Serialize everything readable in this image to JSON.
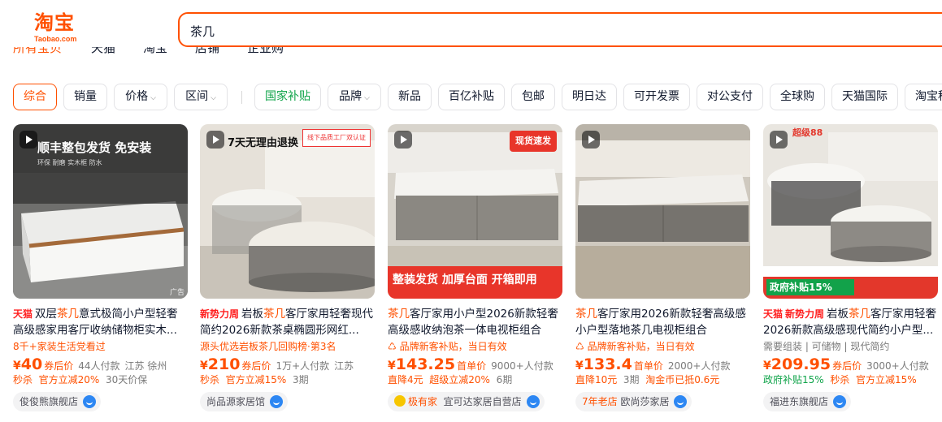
{
  "logo": {
    "cn": "淘宝",
    "en": "Taobao.com"
  },
  "search": {
    "query": "茶几"
  },
  "tabs": [
    {
      "label": "所有宝贝"
    },
    {
      "label": "天猫"
    },
    {
      "label": "淘宝"
    },
    {
      "label": "店铺"
    },
    {
      "label": "企业购"
    }
  ],
  "filters": [
    {
      "label": "综合"
    },
    {
      "label": "销量"
    },
    {
      "label": "价格"
    },
    {
      "label": "区间"
    },
    {
      "label": "国家补贴"
    },
    {
      "label": "品牌"
    },
    {
      "label": "新品"
    },
    {
      "label": "百亿补贴"
    },
    {
      "label": "包邮"
    },
    {
      "label": "明日达"
    },
    {
      "label": "可开发票"
    },
    {
      "label": "对公支付"
    },
    {
      "label": "全球购"
    },
    {
      "label": "天猫国际"
    },
    {
      "label": "淘宝秒"
    }
  ],
  "products": [
    {
      "img_banner": "顺丰整包发货 免安装",
      "img_small": "环保 耐磨 实木框 防水",
      "img_corner": "广告",
      "tag": "天猫",
      "title_a": "双层",
      "title_hl": "茶几",
      "title_b": "意式极简小户型轻奢高级感家用客厅收纳储物柜实木...",
      "sub": "8千+家装生活党看过",
      "sub_grey": "",
      "price_int": "40",
      "price_label": "券后价",
      "sold": "44人付款",
      "location": "江苏 徐州",
      "promo": [
        "秒杀",
        "官方立减20%",
        "30天价保"
      ],
      "store": "俊俊熊旗舰店"
    },
    {
      "img_banner": "7天无理由退换",
      "img_small": "线下品质工厂双认证",
      "img_corner": "",
      "tag": "新势力周",
      "title_a": "岩板",
      "title_hl": "茶几",
      "title_b": "客厅家用轻奢现代简约2026新款茶桌椭圆形网红...",
      "sub": "源头优选岩板茶几回购榜·第3名",
      "sub_grey": "",
      "price_int": "210",
      "price_label": "券后价",
      "sold": "1万+人付款",
      "location": "江苏",
      "promo": [
        "秒杀",
        "官方立减15%",
        "3期"
      ],
      "store": "尚品源家居馆"
    },
    {
      "img_banner": "整装发货 加厚台面 开箱即用",
      "img_small": "现货速发",
      "img_corner": "",
      "tag": "",
      "title_a": "",
      "title_hl": "茶几",
      "title_b": "客厅家用小户型2026新款轻奢高级感收纳泡茶一体电视柜组合",
      "sub": "品牌新客补贴，当日有效",
      "sub_grey": "",
      "price_int": "143.25",
      "price_label": "首单价",
      "sold": "9000+人付款",
      "location": "",
      "promo": [
        "直降4元",
        "超级立减20%",
        "6期"
      ],
      "store": "宜可达家居自营店",
      "store_brand": "极有家"
    },
    {
      "img_banner": "",
      "img_small": "",
      "img_corner": "",
      "tag": "",
      "title_a": "",
      "title_hl": "茶几",
      "title_b": "客厅家用2026新款轻奢高级感小户型落地茶几电视柜组合",
      "sub": "品牌新客补贴，当日有效",
      "sub_grey": "",
      "price_int": "133.4",
      "price_label": "首单价",
      "sold": "2000+人付款",
      "location": "",
      "promo": [
        "直降10元",
        "3期",
        "淘金币已抵0.6元"
      ],
      "store": "欧尚莎家居",
      "store_prefix": "7年老店"
    },
    {
      "img_banner": "超级88",
      "img_small": "政府补贴15%",
      "img_corner": "",
      "tag": "天猫",
      "tag2": "新势力周",
      "title_a": "岩板",
      "title_hl": "茶几",
      "title_b": "客厅家用轻奢2026新款高级感现代简约小户型...",
      "sub": "",
      "sub_grey": "需要组装 | 可储物 | 现代简约",
      "price_int": "209.95",
      "price_label": "券后价",
      "sold": "3000+人付款",
      "location": "",
      "promo": [
        "政府补贴15%",
        "秒杀",
        "官方立减15%"
      ],
      "store": "福进东旗舰店"
    }
  ],
  "colors": {
    "accent": "#ff5000",
    "green": "#10a44a",
    "text": "#11192d",
    "grey": "#7a7a7a"
  }
}
